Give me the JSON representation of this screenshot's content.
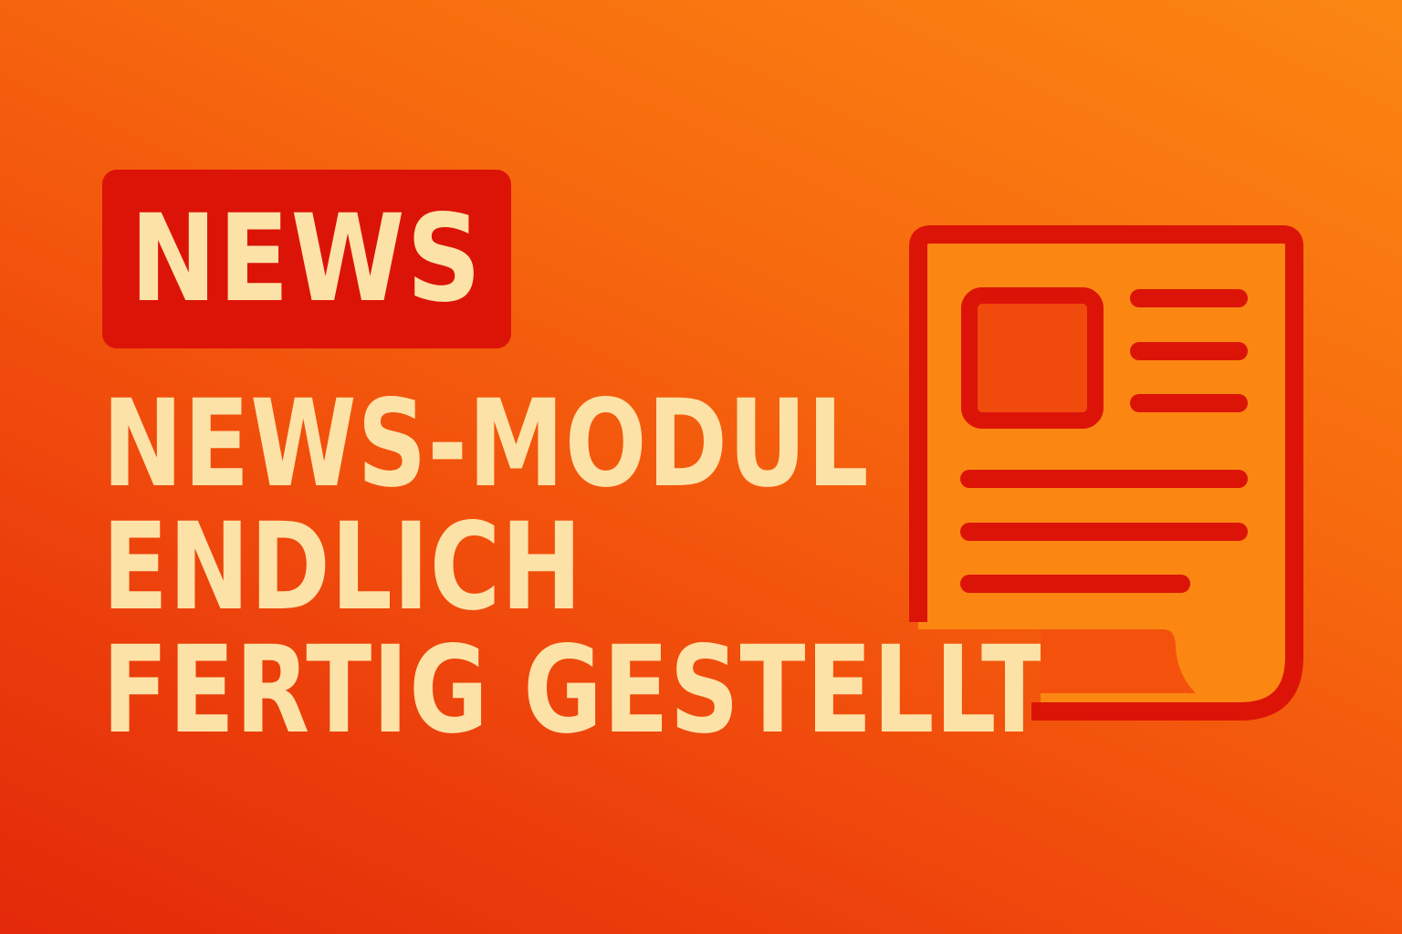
{
  "badge": {
    "label": "NEWS"
  },
  "headline": {
    "lines": [
      "NEWS-MODUL",
      "ENDLICH",
      "FERTIG GESTELLT"
    ]
  },
  "icon": {
    "name": "newspaper-document-icon"
  },
  "colors": {
    "background_start": "#e3290a",
    "background_end": "#fb8712",
    "badge_bg": "#dc1408",
    "text": "#fde2a7",
    "icon_stroke": "#dc1408",
    "icon_fill": "#fb8712"
  }
}
